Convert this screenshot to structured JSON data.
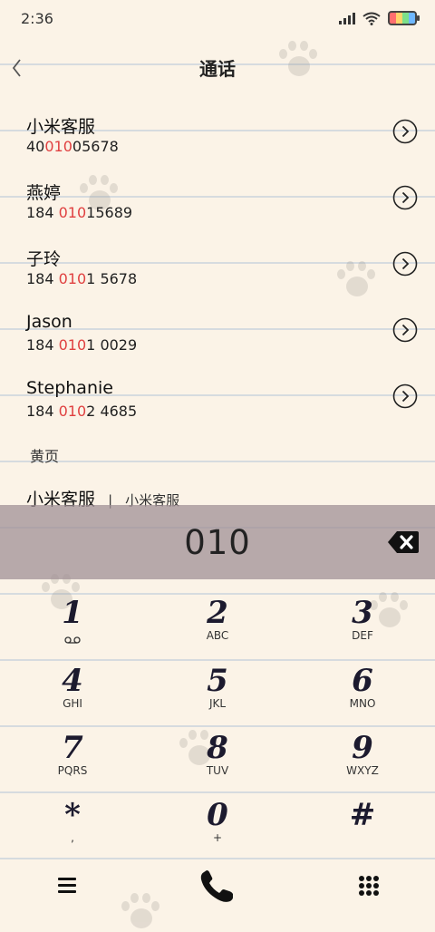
{
  "status_bar": {
    "time": "2:36"
  },
  "header": {
    "title": "通话"
  },
  "contacts": [
    {
      "name": "小米客服",
      "num_pre": "40",
      "num_hl": "010",
      "num_post": "05678"
    },
    {
      "name": "燕婷",
      "num_pre": "184 ",
      "num_hl": "010",
      "num_post": "15689"
    },
    {
      "name": "子玲",
      "num_pre": "184 ",
      "num_hl": "010",
      "num_post": "1 5678"
    },
    {
      "name": "Jason",
      "num_pre": "184 ",
      "num_hl": "010",
      "num_post": "1 0029"
    },
    {
      "name": "Stephanie",
      "num_pre": "184 ",
      "num_hl": "010",
      "num_post": "2 4685"
    }
  ],
  "yellow_pages": {
    "section_label": "黄页",
    "name": "小米客服",
    "separator": "|",
    "sub": "小米客服"
  },
  "dialer": {
    "input": "010",
    "keys": [
      {
        "digit": "1",
        "letters": ""
      },
      {
        "digit": "2",
        "letters": "ABC"
      },
      {
        "digit": "3",
        "letters": "DEF"
      },
      {
        "digit": "4",
        "letters": "GHI"
      },
      {
        "digit": "5",
        "letters": "JKL"
      },
      {
        "digit": "6",
        "letters": "MNO"
      },
      {
        "digit": "7",
        "letters": "PQRS"
      },
      {
        "digit": "8",
        "letters": "TUV"
      },
      {
        "digit": "9",
        "letters": "WXYZ"
      },
      {
        "digit": "*",
        "letters": ","
      },
      {
        "digit": "0",
        "letters": "+"
      },
      {
        "digit": "#",
        "letters": ""
      }
    ]
  },
  "icons": {
    "back": "back-chevron-icon",
    "arrow": "circle-arrow-right-icon",
    "backspace": "backspace-icon",
    "voicemail": "voicemail-icon",
    "menu": "menu-icon",
    "call": "phone-call-icon",
    "keypad": "keypad-grid-icon"
  },
  "colors": {
    "highlight": "#e04040",
    "paper": "#fbf3e7",
    "display_bar": "#a09096"
  }
}
